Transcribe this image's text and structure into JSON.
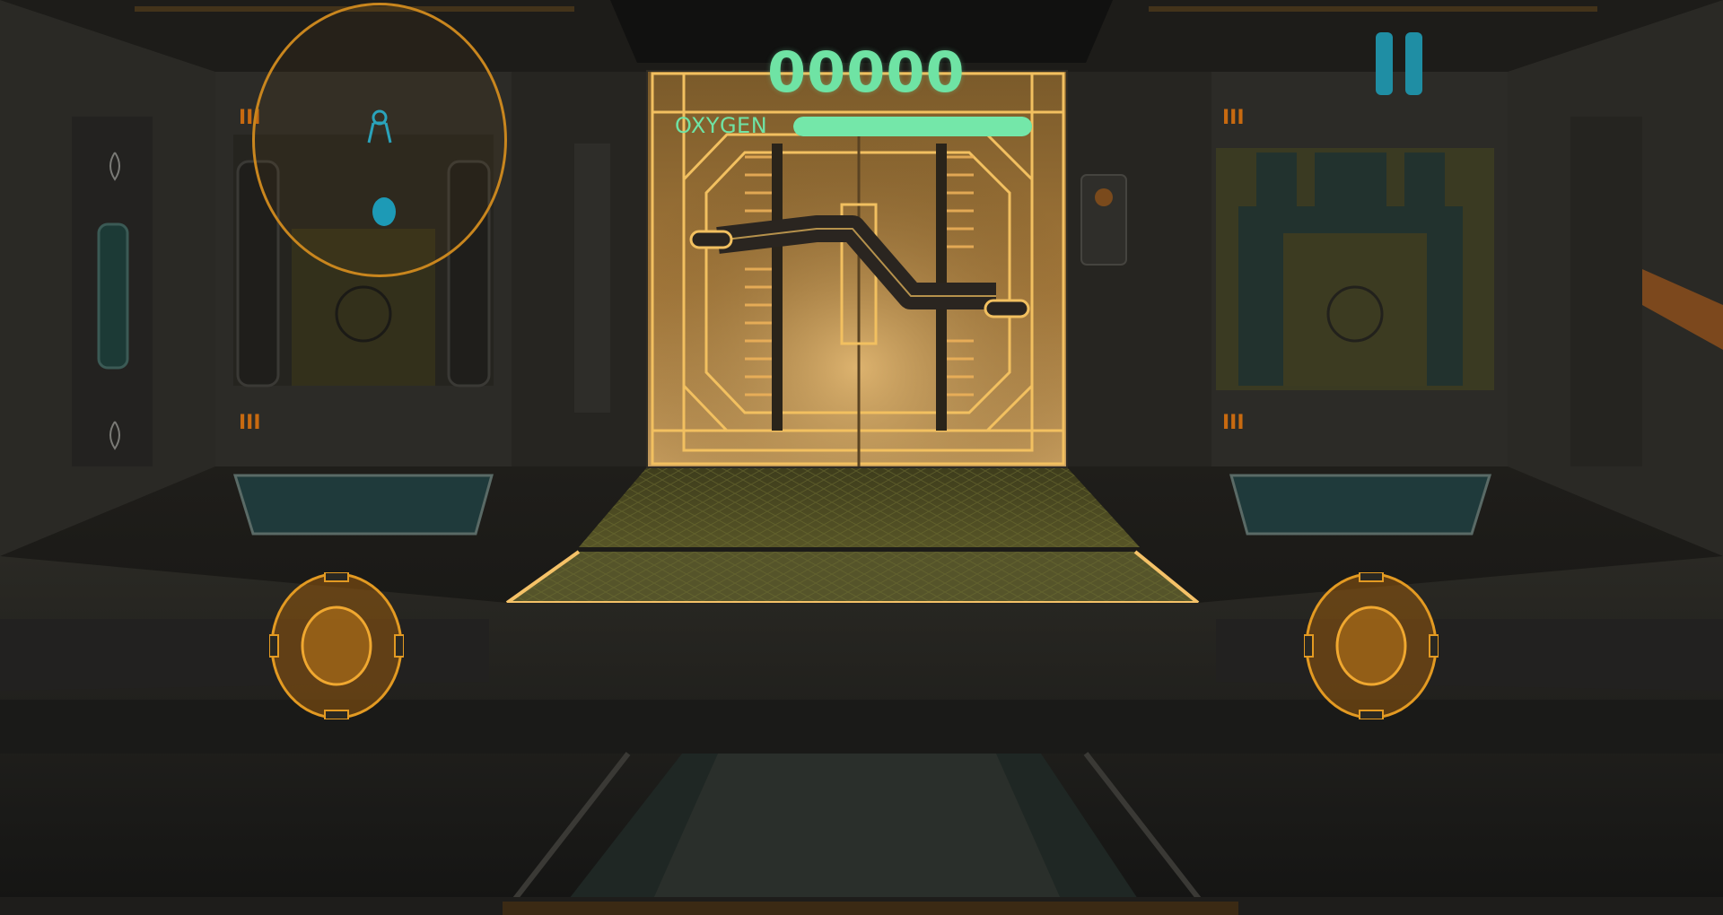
{
  "hud": {
    "score": "00000",
    "oxygen_label": "OXYGEN",
    "oxygen_level": 1.0,
    "pause_icon": "pause-icon",
    "radar": {
      "player_icon": "player-marker-icon",
      "target_icon": "target-dot-icon"
    },
    "left_stick_icon": "joystick-icon",
    "right_stick_icon": "joystick-icon"
  },
  "colors": {
    "hud_green": "#6fe3a4",
    "pause_teal": "#1f8ea4",
    "radar_orange": "#c9861e",
    "door_glow": "#f2c060",
    "joystick_orange": "#e39a22"
  }
}
